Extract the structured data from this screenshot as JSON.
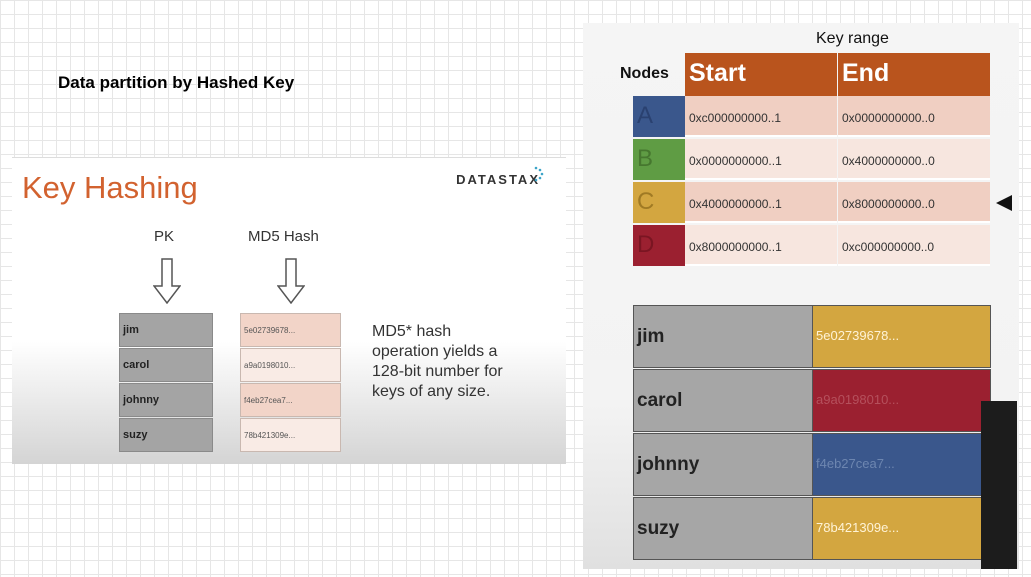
{
  "page": {
    "title": "Data partition by Hashed Key"
  },
  "left_slide": {
    "title": "Key Hashing",
    "brand": "DATASTAX",
    "pk_header": "PK",
    "hash_header": "MD5 Hash",
    "rows": [
      {
        "key": "jim",
        "hash": "5e02739678..."
      },
      {
        "key": "carol",
        "hash": "a9a0198010..."
      },
      {
        "key": "johnny",
        "hash": "f4eb27cea7..."
      },
      {
        "key": "suzy",
        "hash": "78b421309e..."
      }
    ],
    "hash_colors": [
      "#f2d4c8",
      "#f9ebe5",
      "#f2d4c8",
      "#f9ebe5"
    ],
    "note": "MD5* hash operation yields a 128-bit number for keys of any size."
  },
  "right_slide": {
    "key_range_label": "Key range",
    "nodes_label": "Nodes",
    "start_label": "Start",
    "end_label": "End",
    "header_color": "#b9541d",
    "nodes": [
      {
        "name": "A",
        "color": "#3a578c",
        "start": "0xc000000000..1",
        "end": "0x0000000000..0"
      },
      {
        "name": "B",
        "color": "#5f9c44",
        "start": "0x0000000000..1",
        "end": "0x4000000000..0"
      },
      {
        "name": "C",
        "color": "#d3a640",
        "start": "0x4000000000..1",
        "end": "0x8000000000..0"
      },
      {
        "name": "D",
        "color": "#9b2030",
        "start": "0x8000000000..1",
        "end": "0xc000000000..0"
      }
    ],
    "table": [
      {
        "key": "jim",
        "hash": "5e02739678...",
        "color": "#d3a640"
      },
      {
        "key": "carol",
        "hash": "a9a0198010...",
        "color": "#9b2030"
      },
      {
        "key": "johnny",
        "hash": "f4eb27cea7...",
        "color": "#3a578c"
      },
      {
        "key": "suzy",
        "hash": "78b421309e...",
        "color": "#d3a640"
      }
    ]
  }
}
